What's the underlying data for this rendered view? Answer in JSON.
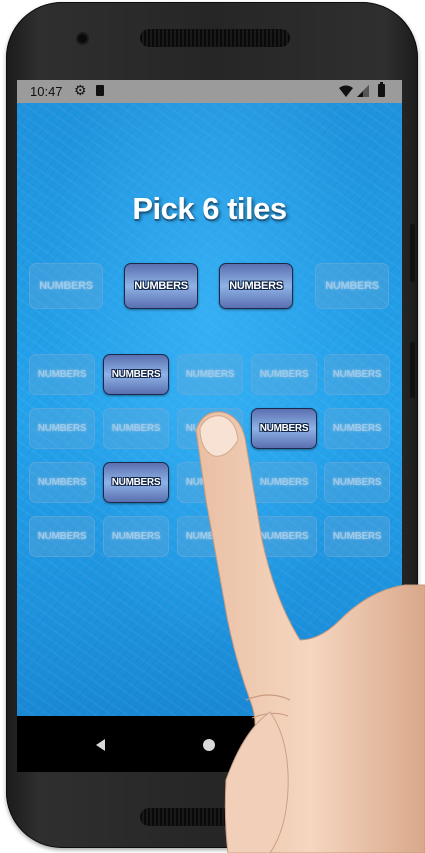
{
  "status_bar": {
    "time": "10:47",
    "settings_icon": "gear-icon",
    "sim_icon": "sd-card-icon",
    "wifi_icon": "wifi-icon",
    "signal_icon": "signal-icon",
    "battery_icon": "battery-icon"
  },
  "game": {
    "title": "Pick 6 tiles",
    "tile_label": "NUMBERS",
    "top_row": [
      {
        "label": "NUMBERS",
        "picked": false
      },
      {
        "label": "NUMBERS",
        "picked": true
      },
      {
        "label": "NUMBERS",
        "picked": true
      },
      {
        "label": "NUMBERS",
        "picked": false
      }
    ],
    "grid": [
      [
        {
          "label": "NUMBERS",
          "picked": false
        },
        {
          "label": "NUMBERS",
          "picked": true
        },
        {
          "label": "NUMBERS",
          "picked": false
        },
        {
          "label": "NUMBERS",
          "picked": false
        },
        {
          "label": "NUMBERS",
          "picked": false
        }
      ],
      [
        {
          "label": "NUMBERS",
          "picked": false
        },
        {
          "label": "NUMBERS",
          "picked": false
        },
        {
          "label": "NUMBERS",
          "picked": false
        },
        {
          "label": "NUMBERS",
          "picked": true
        },
        {
          "label": "NUMBERS",
          "picked": false
        }
      ],
      [
        {
          "label": "NUMBERS",
          "picked": false
        },
        {
          "label": "NUMBERS",
          "picked": true
        },
        {
          "label": "NUMBERS",
          "picked": false
        },
        {
          "label": "NUMBERS",
          "picked": false
        },
        {
          "label": "NUMBERS",
          "picked": false
        }
      ],
      [
        {
          "label": "NUMBERS",
          "picked": false
        },
        {
          "label": "NUMBERS",
          "picked": false
        },
        {
          "label": "NUMBERS",
          "picked": false
        },
        {
          "label": "NUMBERS",
          "picked": false
        },
        {
          "label": "NUMBERS",
          "picked": false
        }
      ]
    ]
  },
  "nav_bar": {
    "back_icon": "back-triangle-icon",
    "home_icon": "home-circle-icon"
  },
  "colors": {
    "background": "#24a3ec",
    "picked_tile": "#5a6fb0",
    "status_bar": "#9b9b9b"
  }
}
